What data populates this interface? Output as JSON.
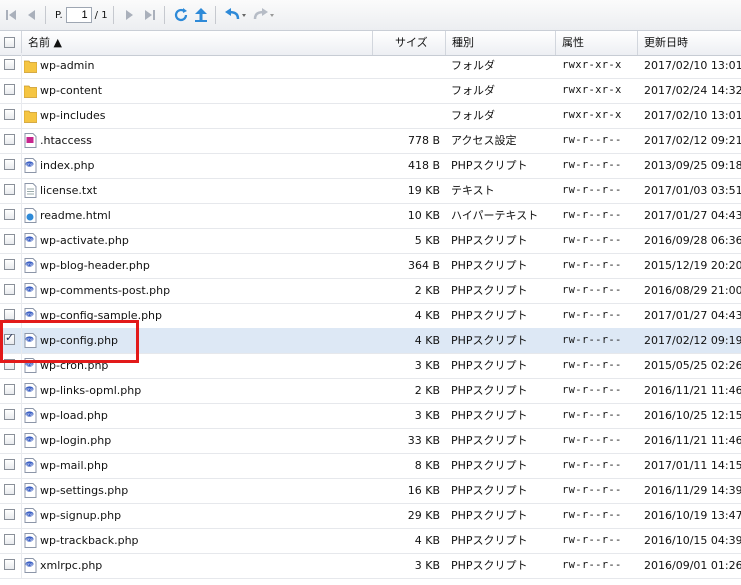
{
  "toolbar": {
    "page_label": "P.",
    "page_value": "1",
    "page_total": "/ 1",
    "buttons": [
      "first-page-icon",
      "prev-page-icon",
      "next-page-icon",
      "last-page-icon",
      "refresh-icon",
      "upload-icon",
      "back-icon",
      "forward-icon"
    ]
  },
  "columns": {
    "name": "名前 ▲",
    "size": "サイズ",
    "kind": "種別",
    "perm": "属性",
    "date": "更新日時"
  },
  "files": [
    {
      "name": "wp-admin",
      "size": "",
      "kind": "フォルダ",
      "perm": "rwxr-xr-x",
      "date": "2017/02/10 13:01",
      "icon": "folder-icon",
      "checked": false
    },
    {
      "name": "wp-content",
      "size": "",
      "kind": "フォルダ",
      "perm": "rwxr-xr-x",
      "date": "2017/02/24 14:32",
      "icon": "folder-icon",
      "checked": false
    },
    {
      "name": "wp-includes",
      "size": "",
      "kind": "フォルダ",
      "perm": "rwxr-xr-x",
      "date": "2017/02/10 13:01",
      "icon": "folder-icon",
      "checked": false
    },
    {
      "name": ".htaccess",
      "size": "778 B",
      "kind": "アクセス設定",
      "perm": "rw-r--r--",
      "date": "2017/02/12 09:21",
      "icon": "htaccess-file-icon",
      "checked": false
    },
    {
      "name": "index.php",
      "size": "418 B",
      "kind": "PHPスクリプト",
      "perm": "rw-r--r--",
      "date": "2013/09/25 09:18",
      "icon": "php-file-icon",
      "checked": false
    },
    {
      "name": "license.txt",
      "size": "19 KB",
      "kind": "テキスト",
      "perm": "rw-r--r--",
      "date": "2017/01/03 03:51",
      "icon": "text-file-icon",
      "checked": false
    },
    {
      "name": "readme.html",
      "size": "10 KB",
      "kind": "ハイパーテキスト",
      "perm": "rw-r--r--",
      "date": "2017/01/27 04:43",
      "icon": "html-file-icon",
      "checked": false
    },
    {
      "name": "wp-activate.php",
      "size": "5 KB",
      "kind": "PHPスクリプト",
      "perm": "rw-r--r--",
      "date": "2016/09/28 06:36",
      "icon": "php-file-icon",
      "checked": false
    },
    {
      "name": "wp-blog-header.php",
      "size": "364 B",
      "kind": "PHPスクリプト",
      "perm": "rw-r--r--",
      "date": "2015/12/19 20:20",
      "icon": "php-file-icon",
      "checked": false
    },
    {
      "name": "wp-comments-post.php",
      "size": "2 KB",
      "kind": "PHPスクリプト",
      "perm": "rw-r--r--",
      "date": "2016/08/29 21:00",
      "icon": "php-file-icon",
      "checked": false
    },
    {
      "name": "wp-config-sample.php",
      "size": "4 KB",
      "kind": "PHPスクリプト",
      "perm": "rw-r--r--",
      "date": "2017/01/27 04:43",
      "icon": "php-file-icon",
      "checked": false
    },
    {
      "name": "wp-config.php",
      "size": "4 KB",
      "kind": "PHPスクリプト",
      "perm": "rw-r--r--",
      "date": "2017/02/12 09:19",
      "icon": "php-file-icon",
      "checked": true
    },
    {
      "name": "wp-cron.php",
      "size": "3 KB",
      "kind": "PHPスクリプト",
      "perm": "rw-r--r--",
      "date": "2015/05/25 02:26",
      "icon": "php-file-icon",
      "checked": false
    },
    {
      "name": "wp-links-opml.php",
      "size": "2 KB",
      "kind": "PHPスクリプト",
      "perm": "rw-r--r--",
      "date": "2016/11/21 11:46",
      "icon": "php-file-icon",
      "checked": false
    },
    {
      "name": "wp-load.php",
      "size": "3 KB",
      "kind": "PHPスクリプト",
      "perm": "rw-r--r--",
      "date": "2016/10/25 12:15",
      "icon": "php-file-icon",
      "checked": false
    },
    {
      "name": "wp-login.php",
      "size": "33 KB",
      "kind": "PHPスクリプト",
      "perm": "rw-r--r--",
      "date": "2016/11/21 11:46",
      "icon": "php-file-icon",
      "checked": false
    },
    {
      "name": "wp-mail.php",
      "size": "8 KB",
      "kind": "PHPスクリプト",
      "perm": "rw-r--r--",
      "date": "2017/01/11 14:15",
      "icon": "php-file-icon",
      "checked": false
    },
    {
      "name": "wp-settings.php",
      "size": "16 KB",
      "kind": "PHPスクリプト",
      "perm": "rw-r--r--",
      "date": "2016/11/29 14:39",
      "icon": "php-file-icon",
      "checked": false
    },
    {
      "name": "wp-signup.php",
      "size": "29 KB",
      "kind": "PHPスクリプト",
      "perm": "rw-r--r--",
      "date": "2016/10/19 13:47",
      "icon": "php-file-icon",
      "checked": false
    },
    {
      "name": "wp-trackback.php",
      "size": "4 KB",
      "kind": "PHPスクリプト",
      "perm": "rw-r--r--",
      "date": "2016/10/15 04:39",
      "icon": "php-file-icon",
      "checked": false
    },
    {
      "name": "xmlrpc.php",
      "size": "3 KB",
      "kind": "PHPスクリプト",
      "perm": "rw-r--r--",
      "date": "2016/09/01 01:26",
      "icon": "php-file-icon",
      "checked": false
    }
  ],
  "colors": {
    "selected_row": "#dde8f5",
    "highlight_border": "#e21a1a",
    "folder": "#f5c542",
    "php_icon": "#3b5fc4"
  }
}
